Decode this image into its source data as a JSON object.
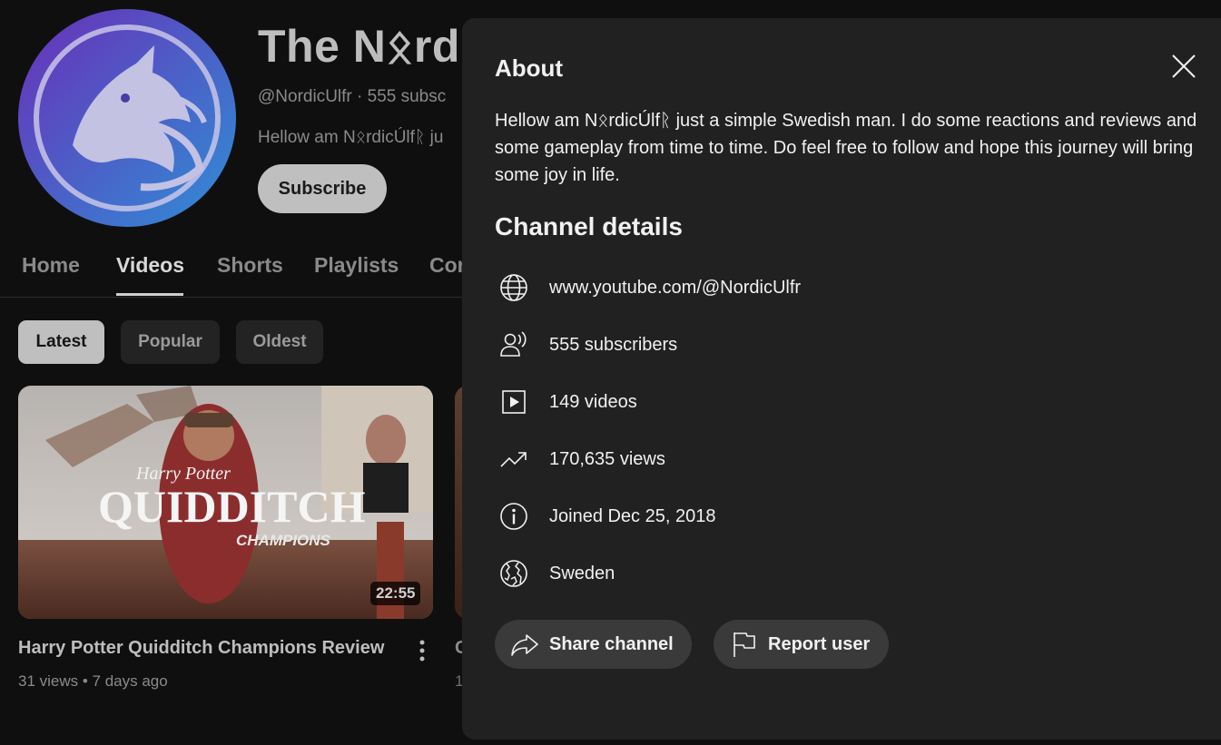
{
  "channel": {
    "title": "The Nᛟrdi",
    "meta": "@NordicUlfr · 555 subsc",
    "desc_peek": "Hellow am NᛟrdicÚlfᚱ ju",
    "subscribe_label": "Subscribe"
  },
  "tabs": [
    {
      "label": "Home"
    },
    {
      "label": "Videos"
    },
    {
      "label": "Shorts"
    },
    {
      "label": "Playlists"
    },
    {
      "label": "Cor"
    }
  ],
  "chips": [
    {
      "label": "Latest"
    },
    {
      "label": "Popular"
    },
    {
      "label": "Oldest"
    }
  ],
  "video": {
    "thumb_brand": "Harry Potter",
    "thumb_title": "QUIDDITCH",
    "thumb_sub": "CHAMPIONS",
    "duration": "22:55",
    "title": "Harry Potter Quidditch Champions Review",
    "meta": "31 views • 7 days ago",
    "peek_title": "C",
    "peek_meta": "1"
  },
  "about": {
    "title": "About",
    "text": "Hellow am NᛟrdicÚlfᚱ just a simple Swedish man. I do some reactions and reviews and some gameplay from time to time. Do feel free to follow and hope this journey will bring some joy in life.",
    "details_title": "Channel details",
    "details": [
      {
        "icon": "globe-icon",
        "text": "www.youtube.com/@NordicUlfr"
      },
      {
        "icon": "subscribers-icon",
        "text": "555 subscribers"
      },
      {
        "icon": "video-icon",
        "text": "149 videos"
      },
      {
        "icon": "trending-icon",
        "text": "170,635 views"
      },
      {
        "icon": "info-icon",
        "text": "Joined Dec 25, 2018"
      },
      {
        "icon": "world-icon",
        "text": "Sweden"
      }
    ],
    "share_label": "Share channel",
    "report_label": "Report user"
  },
  "colors": {
    "page_bg": "#0f0f0f",
    "dialog_bg": "#212121",
    "pill_bg": "#3a3a3a",
    "avatar_gradient": [
      "#7b3fc8",
      "#3a8fd6"
    ]
  }
}
